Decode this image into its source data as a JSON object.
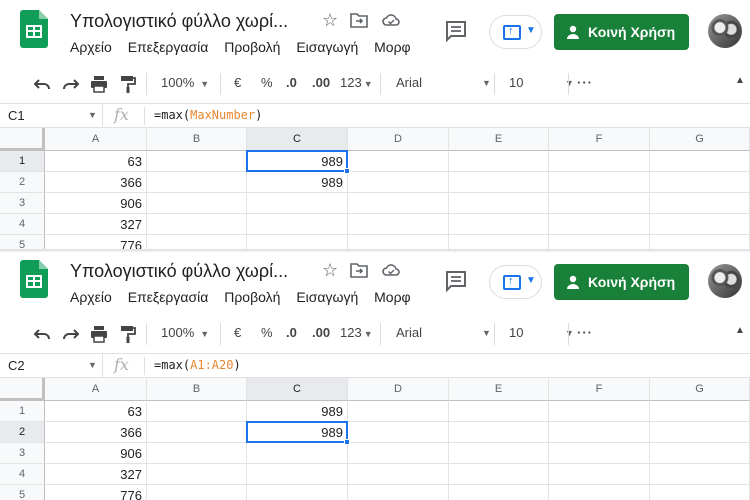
{
  "app": {
    "title": "Υπολογιστικό φύλλο χωρί...",
    "menu": [
      "Αρχείο",
      "Επεξεργασία",
      "Προβολή",
      "Εισαγωγή",
      "Μορφ"
    ],
    "share_label": "Κοινή Χρήση",
    "accent_color": "#1a73e8",
    "share_color": "#188038"
  },
  "toolbar": {
    "zoom": "100%",
    "currency": "€",
    "percent": "%",
    "decrease_decimal": ".0",
    "increase_decimal": ".00",
    "more_formats": "123",
    "font": "Arial",
    "font_size": "10",
    "more": "···"
  },
  "grid": {
    "columns": [
      "A",
      "B",
      "C",
      "D",
      "E",
      "F",
      "G"
    ],
    "rows": [
      "1",
      "2",
      "3",
      "4",
      "5"
    ],
    "column_a": [
      "63",
      "366",
      "906",
      "327",
      "776"
    ]
  },
  "panels": [
    {
      "cell_ref": "C1",
      "formula_prefix": "=max(",
      "formula_ref": "MaxNumber",
      "formula_suffix": ")",
      "column_c": [
        "989",
        "989"
      ]
    },
    {
      "cell_ref": "C2",
      "formula_prefix": "=max(",
      "formula_ref": "A1:A20",
      "formula_suffix": ")",
      "column_c": [
        "989",
        "989"
      ]
    }
  ]
}
